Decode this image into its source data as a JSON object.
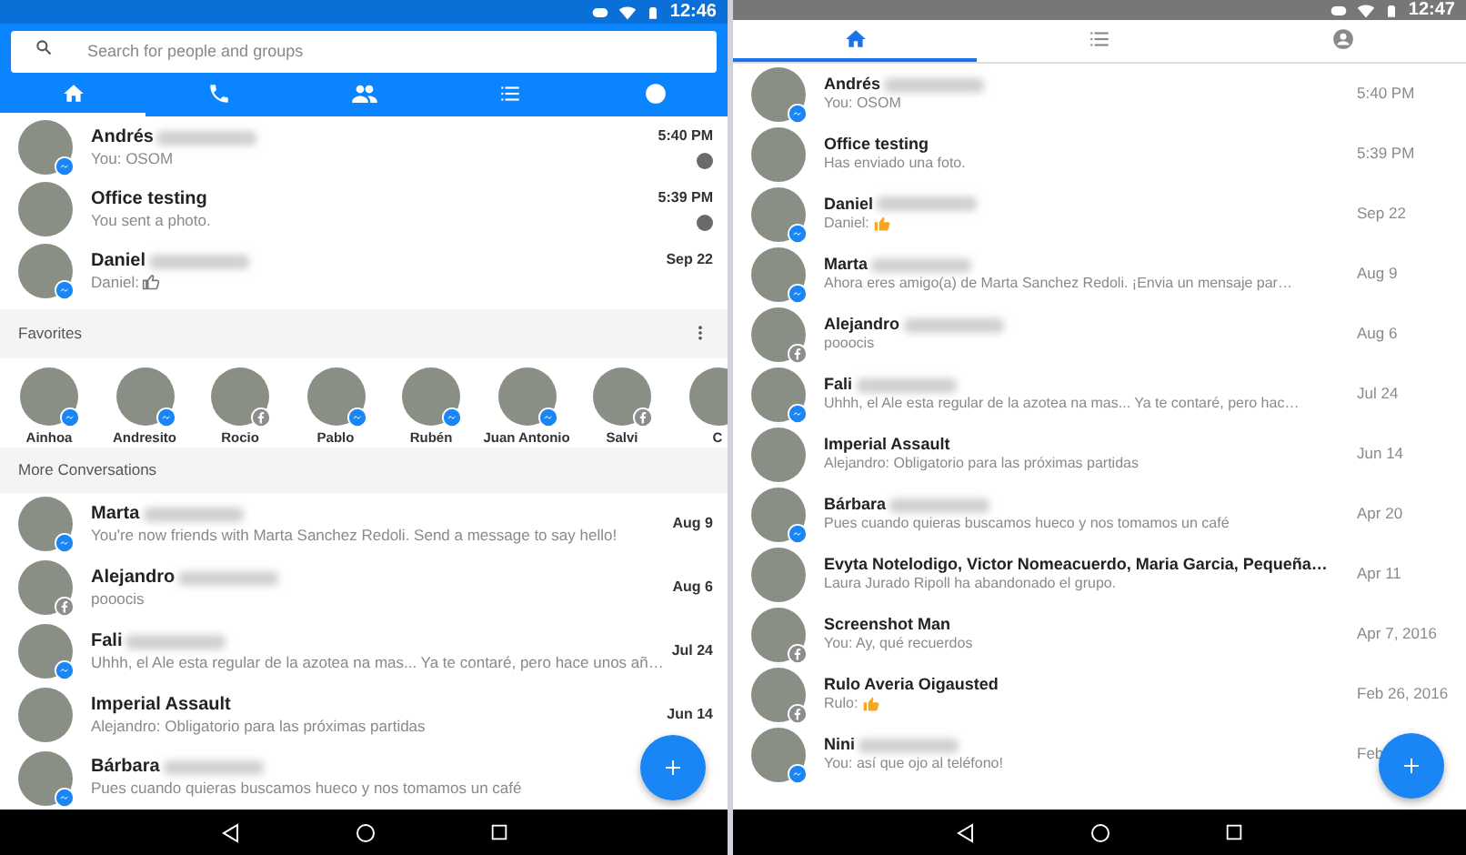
{
  "left_screen": {
    "status_bar": {
      "time": "12:46"
    },
    "search": {
      "placeholder": "Search for people and groups"
    },
    "tabs": [
      {
        "kind": "home",
        "selected": true
      },
      {
        "kind": "phone",
        "selected": false
      },
      {
        "kind": "people",
        "selected": false
      },
      {
        "kind": "list",
        "selected": false
      },
      {
        "kind": "person",
        "selected": false
      }
    ],
    "recent": [
      {
        "name": "Andrés",
        "redacted": true,
        "message": "You: OSOM",
        "thumbs_up": false,
        "time": "5:40 PM",
        "kind": "messenger",
        "seen": true
      },
      {
        "name": "Office testing",
        "redacted": false,
        "message": "You sent a photo.",
        "thumbs_up": false,
        "time": "5:39 PM",
        "kind": "plain",
        "seen": true
      },
      {
        "name": "Daniel",
        "redacted": true,
        "message": "Daniel:",
        "thumbs_up": true,
        "time": "Sep 22",
        "kind": "messenger",
        "seen": false
      }
    ],
    "favorites": {
      "title": "Favorites",
      "items": [
        {
          "name": "Ainhoa",
          "kind": "messenger"
        },
        {
          "name": "Andresito",
          "kind": "messenger"
        },
        {
          "name": "Rocio",
          "kind": "facebook"
        },
        {
          "name": "Pablo",
          "kind": "messenger"
        },
        {
          "name": "Rubén",
          "kind": "messenger"
        },
        {
          "name": "Juan Antonio",
          "kind": "messenger"
        },
        {
          "name": "Salvi",
          "kind": "facebook"
        },
        {
          "name": "C",
          "kind": "plain"
        }
      ]
    },
    "more_conversations": {
      "title": "More Conversations",
      "items": [
        {
          "name": "Marta",
          "redacted": true,
          "message": "You're now friends with Marta Sanchez Redoli. Send a message to say hello!",
          "thumbs_up": false,
          "time": "Aug 9",
          "kind": "messenger"
        },
        {
          "name": "Alejandro",
          "redacted": true,
          "message": "pooocis",
          "thumbs_up": false,
          "time": "Aug 6",
          "kind": "facebook"
        },
        {
          "name": "Fali",
          "redacted": true,
          "message": "Uhhh, el Ale esta regular de la azotea na mas... Ya te contaré, pero hace unos añ…",
          "thumbs_up": false,
          "time": "Jul 24",
          "kind": "messenger"
        },
        {
          "name": "Imperial Assault",
          "redacted": false,
          "message": "Alejandro: Obligatorio para las próximas partidas",
          "thumbs_up": false,
          "time": "Jun 14",
          "kind": "plain"
        },
        {
          "name": "Bárbara",
          "redacted": true,
          "message": "Pues cuando quieras buscamos hueco y nos tomamos un café",
          "thumbs_up": false,
          "kind": "messenger"
        }
      ]
    }
  },
  "right_screen": {
    "status_bar": {
      "time": "12:47"
    },
    "tabs": [
      {
        "kind": "home",
        "selected": true
      },
      {
        "kind": "list",
        "selected": false
      },
      {
        "kind": "person",
        "selected": false
      }
    ],
    "conversations": [
      {
        "name": "Andrés",
        "redacted": true,
        "message": "You: OSOM",
        "thumbs_up": false,
        "time": "5:40 PM",
        "kind": "messenger"
      },
      {
        "name": "Office testing",
        "redacted": false,
        "message": "Has enviado una foto.",
        "thumbs_up": false,
        "time": "5:39 PM",
        "kind": "plain"
      },
      {
        "name": "Daniel",
        "redacted": true,
        "message": "Daniel:",
        "thumbs_up": true,
        "time": "Sep 22",
        "kind": "messenger"
      },
      {
        "name": "Marta",
        "redacted": true,
        "message": "Ahora eres amigo(a) de Marta Sanchez Redoli. ¡Envia un mensaje par…",
        "thumbs_up": false,
        "time": "Aug 9",
        "kind": "messenger"
      },
      {
        "name": "Alejandro",
        "redacted": true,
        "message": "pooocis",
        "thumbs_up": false,
        "time": "Aug 6",
        "kind": "facebook"
      },
      {
        "name": "Fali",
        "redacted": true,
        "message": "Uhhh, el Ale esta regular de la azotea na mas... Ya te contaré, pero hac…",
        "thumbs_up": false,
        "time": "Jul 24",
        "kind": "messenger"
      },
      {
        "name": "Imperial Assault",
        "redacted": false,
        "message": "Alejandro: Obligatorio para las próximas partidas",
        "thumbs_up": false,
        "time": "Jun 14",
        "kind": "plain"
      },
      {
        "name": "Bárbara",
        "redacted": true,
        "message": "Pues cuando quieras buscamos hueco y nos tomamos un café",
        "thumbs_up": false,
        "time": "Apr 20",
        "kind": "messenger"
      },
      {
        "name": "Evyta Notelodigo, Victor Nomeacuerdo, Maria Garcia, Pequeña…",
        "redacted": false,
        "message": "Laura Jurado Ripoll ha abandonado el grupo.",
        "thumbs_up": false,
        "time": "Apr 11",
        "kind": "plain"
      },
      {
        "name": "Screenshot Man",
        "redacted": false,
        "message": "You: Ay, qué recuerdos",
        "thumbs_up": false,
        "time": "Apr 7, 2016",
        "kind": "facebook"
      },
      {
        "name": "Rulo Averia Oigausted",
        "redacted": false,
        "message": "Rulo:",
        "thumbs_up": true,
        "time": "Feb 26, 2016",
        "kind": "facebook"
      },
      {
        "name": "Nini",
        "redacted": true,
        "message": "You: así que ojo al teléfono!",
        "thumbs_up": false,
        "time": "Feb",
        "kind": "messenger"
      }
    ]
  }
}
